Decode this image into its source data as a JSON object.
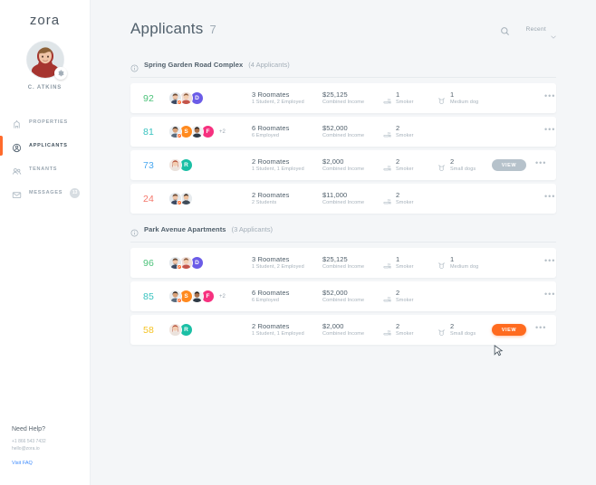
{
  "brand": {
    "name": "zora"
  },
  "sidebar": {
    "profile": {
      "name": "C. ATKINS",
      "badge_icon": "gear-icon"
    },
    "items": [
      {
        "label": "PROPERTIES",
        "icon": "building-icon",
        "active": false,
        "badge": ""
      },
      {
        "label": "APPLICANTS",
        "icon": "applicant-icon",
        "active": true,
        "badge": ""
      },
      {
        "label": "TENANTS",
        "icon": "people-icon",
        "active": false,
        "badge": ""
      },
      {
        "label": "MESSAGES",
        "icon": "envelope-icon",
        "active": false,
        "badge": "13"
      }
    ],
    "help": {
      "title": "Need Help?",
      "phone": "+1 866 543 7432",
      "email": "hello@zora.io",
      "link": "Visit FAQ"
    }
  },
  "header": {
    "title": "Applicants",
    "count": "7",
    "search_icon": "search-icon",
    "sort_label": "Recent",
    "sort_chevron": "chevron-down-icon"
  },
  "groups": [
    {
      "name": "Spring Garden Road Complex",
      "count": "(4 Applicants)",
      "info_icon": "info-icon",
      "rows": [
        {
          "score": "92",
          "score_color": "#4cc27a",
          "avatars": [
            {
              "type": "photo",
              "variant": "m1",
              "verified": true
            },
            {
              "type": "photo",
              "variant": "m2",
              "verified": false
            },
            {
              "type": "initial",
              "letter": "D",
              "color": "#6b5ce7"
            }
          ],
          "more": "",
          "roommates": "3 Roomates",
          "roommates_sub": "1 Student, 2 Employed",
          "income": "$25,125",
          "income_sub": "Combined Income",
          "stat1": {
            "icon": "smoker-icon",
            "value": "1",
            "label": "Smoker"
          },
          "stat2": {
            "icon": "pet-icon",
            "value": "1",
            "label": "Medium dog"
          },
          "view_button": "",
          "view_style": "",
          "menu": "•••"
        },
        {
          "score": "81",
          "score_color": "#37c2bf",
          "avatars": [
            {
              "type": "photo",
              "variant": "f1",
              "verified": true
            },
            {
              "type": "initial",
              "letter": "S",
              "color": "#ff8a1f"
            },
            {
              "type": "photo",
              "variant": "m3",
              "verified": false
            },
            {
              "type": "initial",
              "letter": "F",
              "color": "#f6317f"
            }
          ],
          "more": "+2",
          "roommates": "6 Roomates",
          "roommates_sub": "6 Employed",
          "income": "$52,000",
          "income_sub": "Combined Income",
          "stat1": {
            "icon": "smoker-icon",
            "value": "2",
            "label": "Smoker"
          },
          "stat2": {
            "icon": "",
            "value": "",
            "label": ""
          },
          "view_button": "",
          "view_style": "",
          "menu": "•••"
        },
        {
          "score": "73",
          "score_color": "#4aa8f0",
          "avatars": [
            {
              "type": "photo",
              "variant": "f2",
              "verified": false
            },
            {
              "type": "initial",
              "letter": "R",
              "color": "#1bbfa5"
            }
          ],
          "more": "",
          "roommates": "2 Roomates",
          "roommates_sub": "1 Student, 1 Employed",
          "income": "$2,000",
          "income_sub": "Combined Income",
          "stat1": {
            "icon": "smoker-icon",
            "value": "2",
            "label": "Smoker"
          },
          "stat2": {
            "icon": "pet-icon",
            "value": "2",
            "label": "Small dogs"
          },
          "view_button": "VIEW",
          "view_style": "grey",
          "menu": "•••"
        },
        {
          "score": "24",
          "score_color": "#f4766a",
          "avatars": [
            {
              "type": "photo",
              "variant": "m1",
              "verified": true
            },
            {
              "type": "photo",
              "variant": "m4",
              "verified": false
            }
          ],
          "more": "",
          "roommates": "2 Roomates",
          "roommates_sub": "2 Students",
          "income": "$11,000",
          "income_sub": "Combined Income",
          "stat1": {
            "icon": "smoker-icon",
            "value": "2",
            "label": "Smoker"
          },
          "stat2": {
            "icon": "",
            "value": "",
            "label": ""
          },
          "view_button": "",
          "view_style": "",
          "menu": "•••"
        }
      ]
    },
    {
      "name": "Park Avenue Apartments",
      "count": "(3 Applicants)",
      "info_icon": "info-icon",
      "rows": [
        {
          "score": "96",
          "score_color": "#4cc27a",
          "avatars": [
            {
              "type": "photo",
              "variant": "m1",
              "verified": true
            },
            {
              "type": "photo",
              "variant": "m2",
              "verified": false
            },
            {
              "type": "initial",
              "letter": "D",
              "color": "#6b5ce7"
            }
          ],
          "more": "",
          "roommates": "3 Roomates",
          "roommates_sub": "1 Student, 2 Employed",
          "income": "$25,125",
          "income_sub": "Combined Income",
          "stat1": {
            "icon": "smoker-icon",
            "value": "1",
            "label": "Smoker"
          },
          "stat2": {
            "icon": "pet-icon",
            "value": "1",
            "label": "Medium dog"
          },
          "view_button": "",
          "view_style": "",
          "menu": "•••"
        },
        {
          "score": "85",
          "score_color": "#37c2bf",
          "avatars": [
            {
              "type": "photo",
              "variant": "f1",
              "verified": true
            },
            {
              "type": "initial",
              "letter": "S",
              "color": "#ff8a1f"
            },
            {
              "type": "photo",
              "variant": "m3",
              "verified": false
            },
            {
              "type": "initial",
              "letter": "F",
              "color": "#f6317f"
            }
          ],
          "more": "+2",
          "roommates": "6 Roomates",
          "roommates_sub": "6 Employed",
          "income": "$52,000",
          "income_sub": "Combined Income",
          "stat1": {
            "icon": "smoker-icon",
            "value": "2",
            "label": "Smoker"
          },
          "stat2": {
            "icon": "",
            "value": "",
            "label": ""
          },
          "view_button": "",
          "view_style": "",
          "menu": "•••"
        },
        {
          "score": "58",
          "score_color": "#f5c324",
          "avatars": [
            {
              "type": "photo",
              "variant": "f2",
              "verified": false
            },
            {
              "type": "initial",
              "letter": "R",
              "color": "#1bbfa5"
            }
          ],
          "more": "",
          "roommates": "2 Roomates",
          "roommates_sub": "1 Student, 1 Employed",
          "income": "$2,000",
          "income_sub": "Combined Income",
          "stat1": {
            "icon": "smoker-icon",
            "value": "2",
            "label": "Smoker"
          },
          "stat2": {
            "icon": "pet-icon",
            "value": "2",
            "label": "Small dogs"
          },
          "view_button": "VIEW",
          "view_style": "orange",
          "menu": "•••"
        }
      ]
    }
  ],
  "colors": {
    "accent": "#ff6b2c",
    "page_bg": "#f4f6f8",
    "card_bg": "#ffffff"
  }
}
